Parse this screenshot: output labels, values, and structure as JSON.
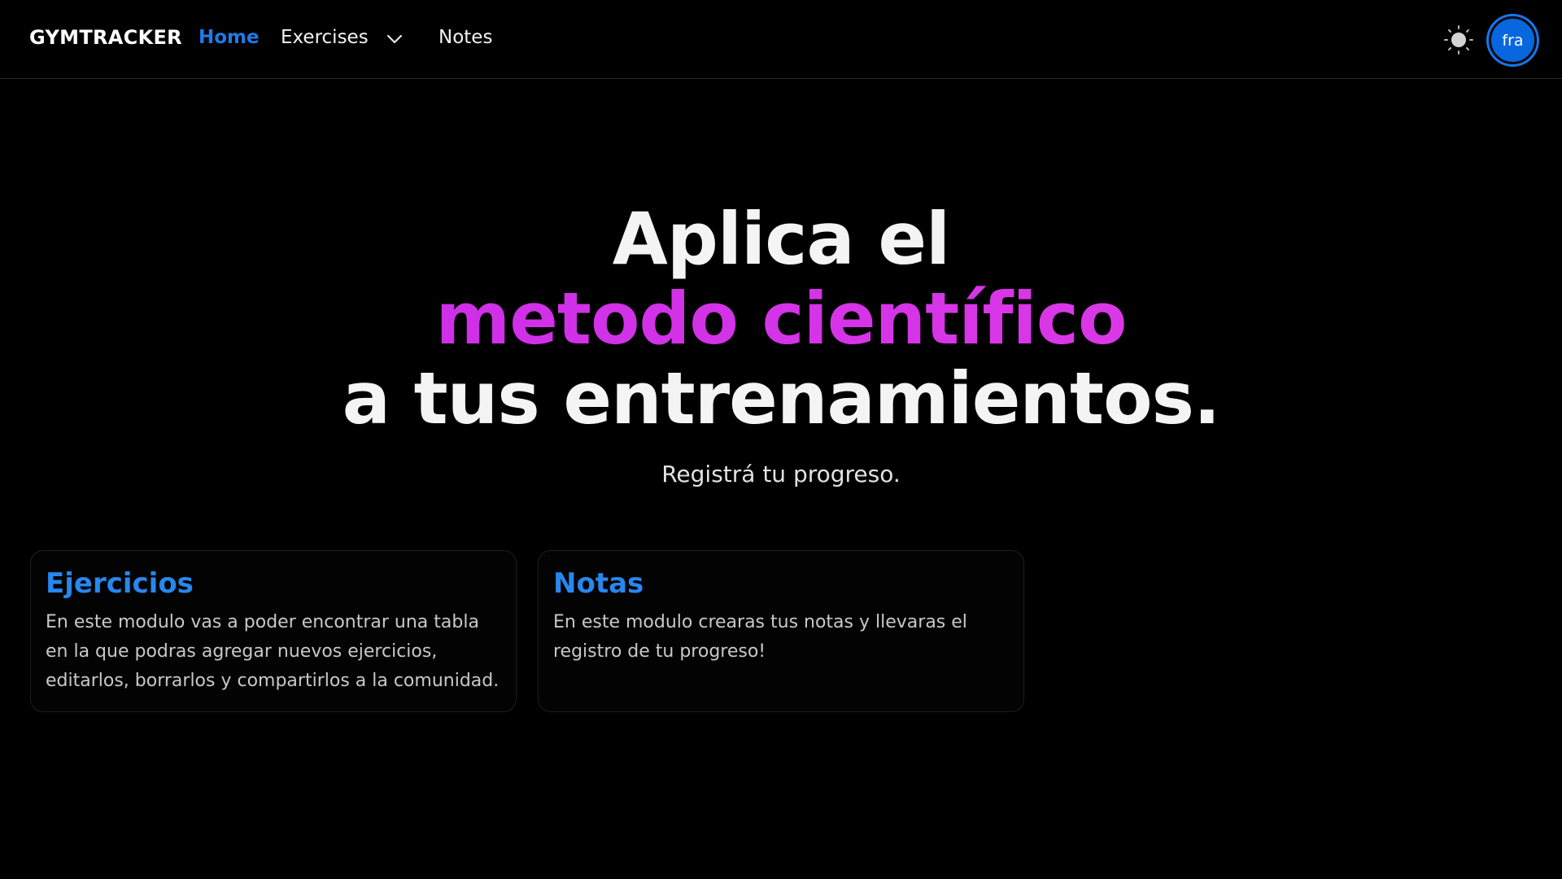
{
  "nav": {
    "brand": "GYMTRACKER",
    "home": "Home",
    "exercises": "Exercises",
    "notes": "Notes",
    "avatar_initials": "fra",
    "active_color": "#1f7ae8",
    "theme_icon": "sun-icon",
    "dropdown_icon": "chevron-down-icon"
  },
  "hero": {
    "line1": "Aplica el",
    "line2": "metodo científico",
    "line3": "a tus entrenamientos.",
    "subtitle": "Registrá tu progreso.",
    "accent_color": "#d62ce6"
  },
  "cards": [
    {
      "title": "Ejercicios",
      "text": "En este modulo vas a poder encontrar una tabla en la que podras agregar nuevos ejercicios, editarlos, borrarlos y compartirlos a la comunidad."
    },
    {
      "title": "Notas",
      "text": "En este modulo crearas tus notas y llevaras el registro de tu progreso!"
    }
  ]
}
